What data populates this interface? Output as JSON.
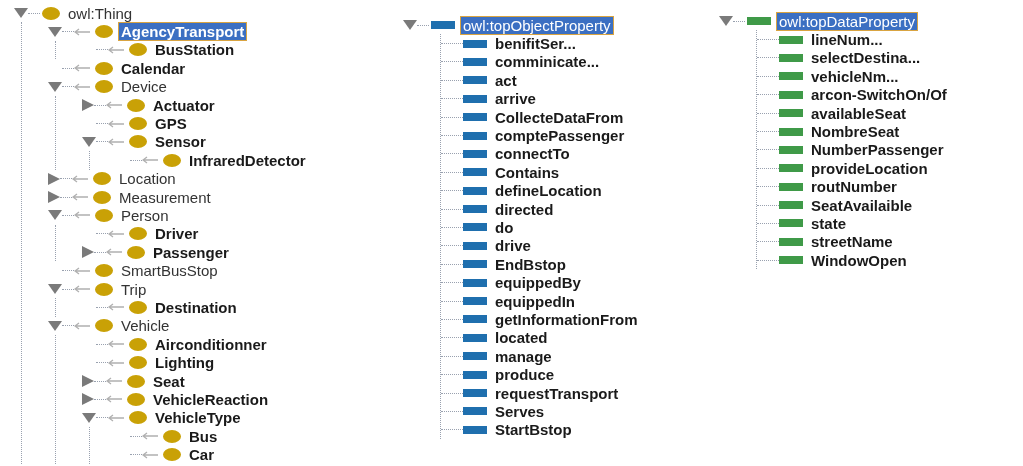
{
  "class_tree": {
    "root": {
      "label": "owl:Thing",
      "bold": false,
      "selected": false,
      "kind": "branch",
      "expanded": true,
      "children": [
        {
          "label": "AgencyTransport",
          "bold": true,
          "selected": true,
          "kind": "branch",
          "expanded": true,
          "children": [
            {
              "label": "BusStation",
              "bold": true,
              "selected": false,
              "kind": "leaf"
            }
          ]
        },
        {
          "label": "Calendar",
          "bold": true,
          "selected": false,
          "kind": "leaf"
        },
        {
          "label": "Device",
          "bold": false,
          "selected": false,
          "kind": "branch",
          "expanded": true,
          "children": [
            {
              "label": "Actuator",
              "bold": true,
              "selected": false,
              "kind": "branch",
              "expanded": false
            },
            {
              "label": "GPS",
              "bold": true,
              "selected": false,
              "kind": "leaf"
            },
            {
              "label": "Sensor",
              "bold": true,
              "selected": false,
              "kind": "branch",
              "expanded": true,
              "children": [
                {
                  "label": "InfraredDetector",
                  "bold": true,
                  "selected": false,
                  "kind": "leaf"
                }
              ]
            }
          ]
        },
        {
          "label": "Location",
          "bold": false,
          "selected": false,
          "kind": "branch",
          "expanded": false
        },
        {
          "label": "Measurement",
          "bold": false,
          "selected": false,
          "kind": "branch",
          "expanded": false
        },
        {
          "label": "Person",
          "bold": false,
          "selected": false,
          "kind": "branch",
          "expanded": true,
          "children": [
            {
              "label": "Driver",
              "bold": true,
              "selected": false,
              "kind": "leaf"
            },
            {
              "label": "Passenger",
              "bold": true,
              "selected": false,
              "kind": "branch",
              "expanded": false
            }
          ]
        },
        {
          "label": "SmartBusStop",
          "bold": false,
          "selected": false,
          "kind": "leaf"
        },
        {
          "label": "Trip",
          "bold": false,
          "selected": false,
          "kind": "branch",
          "expanded": true,
          "children": [
            {
              "label": "Destination",
              "bold": true,
              "selected": false,
              "kind": "leaf"
            }
          ]
        },
        {
          "label": "Vehicle",
          "bold": false,
          "selected": false,
          "kind": "branch",
          "expanded": true,
          "children": [
            {
              "label": "Airconditionner",
              "bold": true,
              "selected": false,
              "kind": "leaf"
            },
            {
              "label": "Lighting",
              "bold": true,
              "selected": false,
              "kind": "leaf"
            },
            {
              "label": "Seat",
              "bold": true,
              "selected": false,
              "kind": "branch",
              "expanded": false
            },
            {
              "label": "VehicleReaction",
              "bold": true,
              "selected": false,
              "kind": "branch",
              "expanded": false
            },
            {
              "label": "VehicleType",
              "bold": true,
              "selected": false,
              "kind": "branch",
              "expanded": true,
              "children": [
                {
                  "label": "Bus",
                  "bold": true,
                  "selected": false,
                  "kind": "leaf"
                },
                {
                  "label": "Car",
                  "bold": true,
                  "selected": false,
                  "kind": "leaf"
                }
              ]
            }
          ]
        }
      ]
    }
  },
  "object_properties": {
    "root": {
      "label": "owl:topObjectProperty",
      "selected": true,
      "expanded": true,
      "children": [
        {
          "label": "benifitSer...",
          "selected": false
        },
        {
          "label": "comminicate...",
          "selected": false
        },
        {
          "label": "act",
          "selected": false
        },
        {
          "label": "arrive",
          "selected": false
        },
        {
          "label": "CollecteDataFrom",
          "selected": false
        },
        {
          "label": "comptePassenger",
          "selected": false
        },
        {
          "label": "connectTo",
          "selected": false
        },
        {
          "label": "Contains",
          "selected": false
        },
        {
          "label": "defineLocation",
          "selected": false
        },
        {
          "label": "directed",
          "selected": false
        },
        {
          "label": "do",
          "selected": false
        },
        {
          "label": "drive",
          "selected": false
        },
        {
          "label": "EndBstop",
          "selected": false
        },
        {
          "label": "equippedBy",
          "selected": false
        },
        {
          "label": "equippedIn",
          "selected": false
        },
        {
          "label": "getInformationFrom",
          "selected": false
        },
        {
          "label": "located",
          "selected": false
        },
        {
          "label": "manage",
          "selected": false
        },
        {
          "label": "produce",
          "selected": false
        },
        {
          "label": "requestTransport",
          "selected": false
        },
        {
          "label": "Serves",
          "selected": false
        },
        {
          "label": "StartBstop",
          "selected": false
        }
      ]
    }
  },
  "data_properties": {
    "root": {
      "label": "owl:topDataProperty",
      "selected": true,
      "expanded": true,
      "children": [
        {
          "label": "lineNum...",
          "selected": false
        },
        {
          "label": "selectDestina...",
          "selected": false
        },
        {
          "label": "vehicleNm...",
          "selected": false
        },
        {
          "label": "arcon-SwitchOn/Of",
          "selected": false
        },
        {
          "label": "availableSeat",
          "selected": false
        },
        {
          "label": "NombreSeat",
          "selected": false
        },
        {
          "label": "NumberPassenger",
          "selected": false
        },
        {
          "label": "provideLocation",
          "selected": false
        },
        {
          "label": "routNumber",
          "selected": false
        },
        {
          "label": "SeatAvailaible",
          "selected": false
        },
        {
          "label": "state",
          "selected": false
        },
        {
          "label": "streetName",
          "selected": false
        },
        {
          "label": "WindowOpen",
          "selected": false
        }
      ]
    }
  }
}
